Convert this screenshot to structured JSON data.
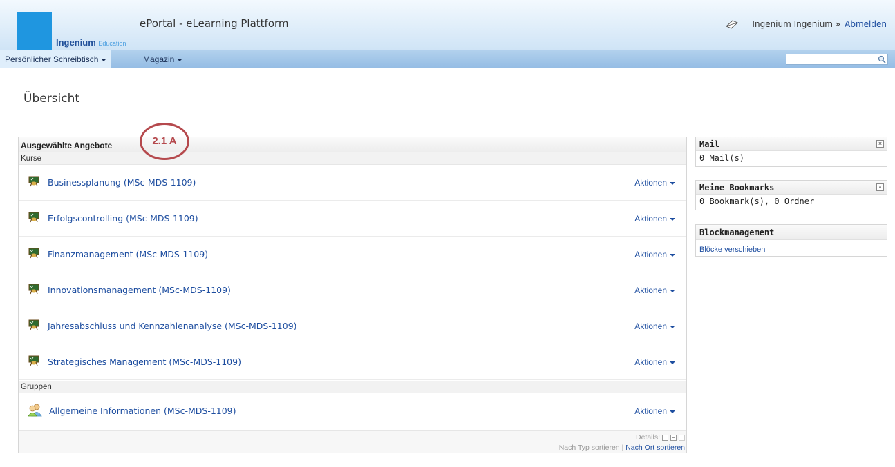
{
  "header": {
    "logo_brand": "Ingenium",
    "logo_sub": "Education",
    "app_title": "ePortal - eLearning Plattform",
    "user_name": "Ingenium Ingenium »",
    "logout_label": "Abmelden"
  },
  "menu": {
    "items": [
      {
        "label": "Persönlicher Schreibtisch"
      },
      {
        "label": "Magazin"
      }
    ],
    "search_placeholder": ""
  },
  "page": {
    "title": "Übersicht"
  },
  "selected_offers": {
    "title": "Ausgewählte Angebote",
    "annotation": "2.1 A",
    "courses_label": "Kurse",
    "courses": [
      {
        "title": "Businessplanung (MSc-MDS-1109)",
        "actions": "Aktionen"
      },
      {
        "title": "Erfolgscontrolling (MSc-MDS-1109)",
        "actions": "Aktionen"
      },
      {
        "title": "Finanzmanagement (MSc-MDS-1109)",
        "actions": "Aktionen"
      },
      {
        "title": "Innovationsmanagement (MSc-MDS-1109)",
        "actions": "Aktionen"
      },
      {
        "title": "Jahresabschluss und Kennzahlenanalyse (MSc-MDS-1109)",
        "actions": "Aktionen"
      },
      {
        "title": "Strategisches Management (MSc-MDS-1109)",
        "actions": "Aktionen"
      }
    ],
    "groups_label": "Gruppen",
    "groups": [
      {
        "title": "Allgemeine Informationen (MSc-MDS-1109)",
        "actions": "Aktionen"
      }
    ],
    "details_label": "Details:",
    "sort_by_type": "Nach Typ sortieren |",
    "sort_by_location": "Nach Ort sortieren"
  },
  "sidebar": {
    "mail": {
      "title": "Mail",
      "body": "0 Mail(s)"
    },
    "bookmarks": {
      "title": "Meine Bookmarks",
      "body": "0 Bookmark(s), 0 Ordner"
    },
    "block_management": {
      "title": "Blockmanagement",
      "link": "Blöcke verschieben"
    }
  },
  "colors": {
    "link": "#1e4ea0",
    "logo_blue": "#1f96e0",
    "annotation": "#b5494d"
  }
}
